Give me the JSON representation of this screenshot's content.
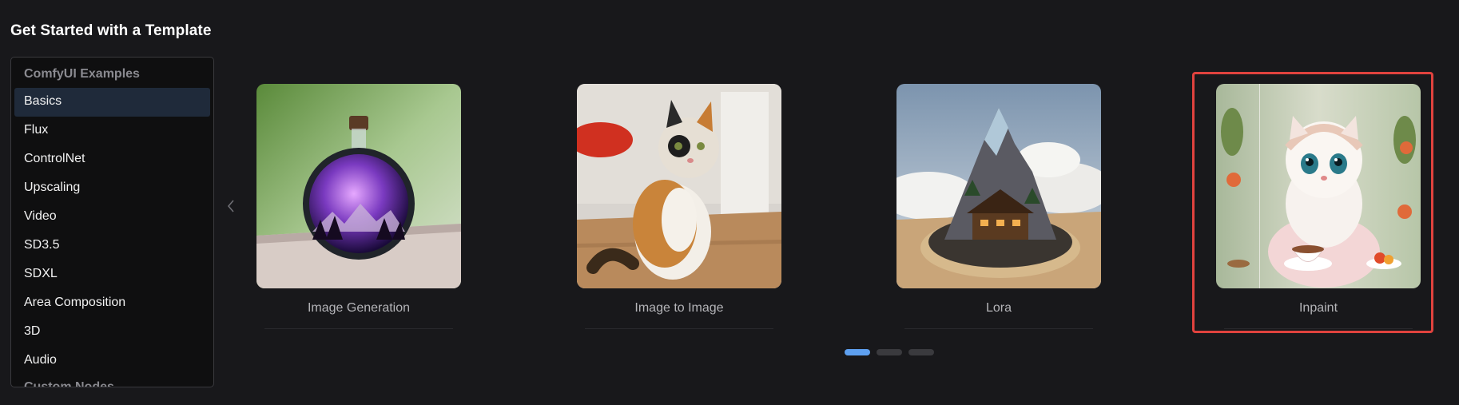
{
  "header": {
    "title": "Get Started with a Template"
  },
  "sidebar": {
    "group_title": "ComfyUI Examples",
    "items": [
      {
        "label": "Basics",
        "active": true
      },
      {
        "label": "Flux"
      },
      {
        "label": "ControlNet"
      },
      {
        "label": "Upscaling"
      },
      {
        "label": "Video"
      },
      {
        "label": "SD3.5"
      },
      {
        "label": "SDXL"
      },
      {
        "label": "Area Composition"
      },
      {
        "label": "3D"
      },
      {
        "label": "Audio"
      }
    ],
    "next_group_title": "Custom Nodes"
  },
  "carousel": {
    "prev_icon": "chevron-left-icon",
    "cards": [
      {
        "label": "Image Generation",
        "image": "bottle-galaxy-image"
      },
      {
        "label": "Image to Image",
        "image": "cat-sitting-image"
      },
      {
        "label": "Lora",
        "image": "mountain-house-image"
      },
      {
        "label": "Inpaint",
        "image": "white-kitten-tea-image",
        "selected": true
      }
    ],
    "pages": 3,
    "active_page": 1
  },
  "colors": {
    "background": "#18181b",
    "selection_border": "#e0423e",
    "active_dot": "#5ea0f0",
    "active_item_bg": "#1f2a3a"
  }
}
